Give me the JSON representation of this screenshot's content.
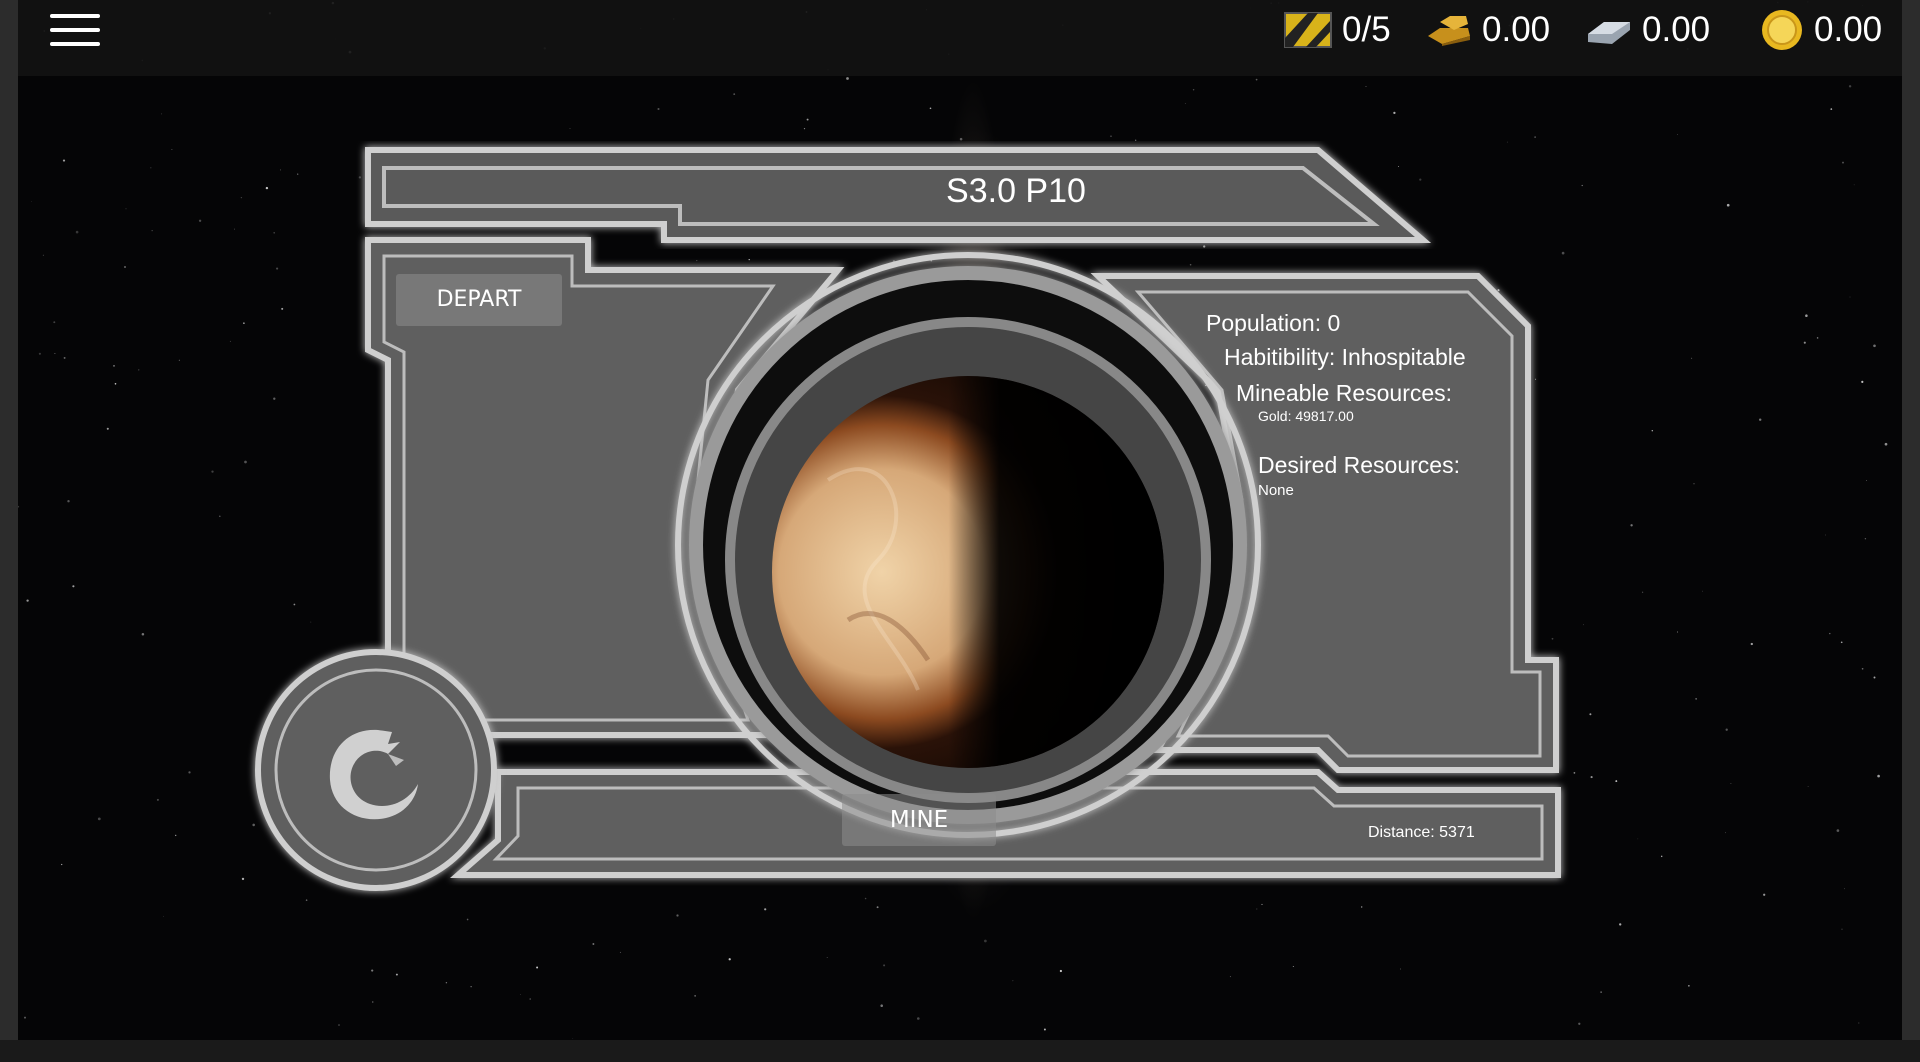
{
  "hud": {
    "menu_icon": "hamburger-menu-icon",
    "cargo": {
      "icon": "hazard-crate-icon",
      "value": "0/5"
    },
    "gold": {
      "icon": "gold-bars-icon",
      "value": "0.00"
    },
    "silver": {
      "icon": "silver-bar-icon",
      "value": "0.00"
    },
    "coins": {
      "icon": "gold-coin-icon",
      "value": "0.00"
    }
  },
  "planet": {
    "title": "S3.0 P10",
    "population": "Population: 0",
    "habitability": "Habitibility: Inhospitable",
    "mineable_heading": "Mineable Resources:",
    "mineable_value": "Gold: 49817.00",
    "desired_heading": "Desired Resources:",
    "desired_value": "None",
    "distance": "Distance: 5371"
  },
  "actions": {
    "depart": "DEPART",
    "mine": "MINE"
  },
  "emblem_icon": "wolf-crescent-emblem-icon",
  "colors": {
    "panel_fill": "#5e5e5e",
    "panel_glow": "#d8d8d8",
    "space": "#050506",
    "planet_light": "#e6c59a",
    "planet_dark": "#1a0d06"
  }
}
